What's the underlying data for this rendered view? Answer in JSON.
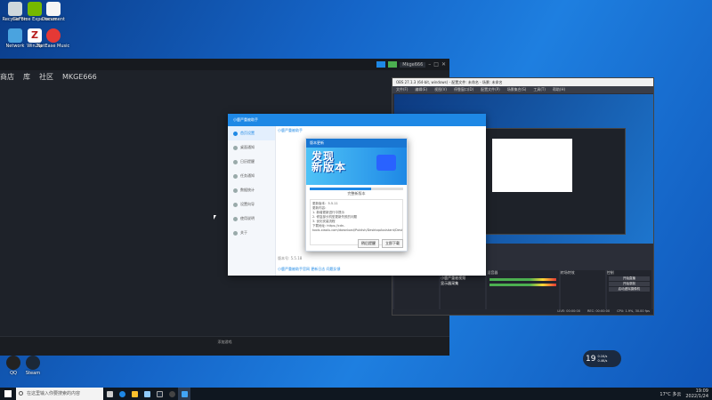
{
  "desktop": {
    "icons": [
      {
        "label": "Recycle Bin",
        "name": "recycle-bin-icon"
      },
      {
        "label": "GeForce Experience",
        "name": "nvidia-icon"
      },
      {
        "label": "Document",
        "name": "document-icon"
      },
      {
        "label": "Network",
        "name": "network-icon"
      },
      {
        "label": "WinZip",
        "name": "winzip-icon"
      },
      {
        "label": "NetEase Music",
        "name": "music-icon"
      },
      {
        "label": "QQ",
        "name": "qq-icon"
      },
      {
        "label": "Steam",
        "name": "steam-icon"
      }
    ]
  },
  "darkwin": {
    "nav": [
      "商店",
      "库",
      "社区",
      "MKGE666"
    ],
    "user_badge": "Mkge666",
    "footer": "添加游戏"
  },
  "obs": {
    "title": "OBS 27.1.3 (64-bit, windows) - 配置文件: 未命名 - 场景: 未命名",
    "menu": [
      "文件(F)",
      "编辑(E)",
      "视图(V)",
      "停靠窗口(D)",
      "配置文件(P)",
      "场景集合(S)",
      "工具(T)",
      "帮助(H)"
    ],
    "docks": {
      "scenes": "场景",
      "sources": "来源",
      "mixer": "混音器",
      "transitions": "转场特效",
      "controls": "控制"
    },
    "sources": [
      "小鹿严重被视频",
      "显示器采集"
    ],
    "controls": [
      "开始直播",
      "开始录制",
      "启动虚拟摄像机",
      "工作室模式",
      "设置",
      "退出"
    ],
    "status": {
      "live": "LIVE: 00:00:00",
      "rec": "REC: 00:00:00",
      "cpu": "CPU: 1.9%, 30.00 fps"
    }
  },
  "mini": {
    "title": "小鹿严重被助手",
    "sidebar": [
      "首页设置",
      "桌面通知",
      "日历提醒",
      "任务通知",
      "数据统计",
      "设置向导",
      "使用说明",
      "关于"
    ],
    "content_title": "小鹿严重被助手",
    "version": "版本号: 5.5.18",
    "footer": "小鹿严重被助手官网  更新日志  问题反馈"
  },
  "update": {
    "title": "版本更新",
    "banner": [
      "发现",
      "新版本"
    ],
    "progress": 0.66,
    "status": "完整新版本",
    "notes": "更新版本：5.5.11\n更新内容：\n1. 新增更新进行中提示\n2. 修复部分机型更新失败的问题\n3. 优化安装流程\n下载地址: https://cdn-tools.xiaolu.com/download/Publish/DesktopAssistant/Desktop_V5.5.11.zip",
    "btn_later": "稍后提醒",
    "btn_now": "立即下载"
  },
  "taskbar": {
    "search_placeholder": "在这里输入你要搜索的内容",
    "weather": "17°C 多云",
    "time": "19:09",
    "date": "2022/1/24"
  },
  "speed": {
    "value": "19",
    "up": "0.1K/s",
    "down": "0.4K/s"
  }
}
